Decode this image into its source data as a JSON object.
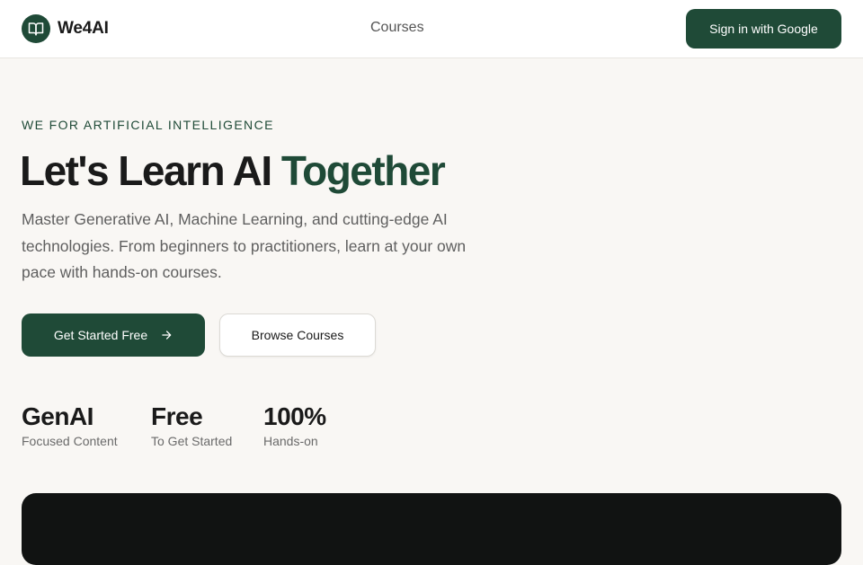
{
  "header": {
    "logo_text": "We4AI",
    "logo_icon": "book-open-icon",
    "nav_courses": "Courses",
    "signin_label": "Sign in with Google"
  },
  "hero": {
    "eyebrow": "WE FOR ARTIFICIAL INTELLIGENCE",
    "title_main": "Let's Learn AI",
    "title_accent": "Together",
    "description": "Master Generative AI, Machine Learning, and cutting-edge AI technologies. From beginners to practitioners, learn at your own pace with hands-on courses.",
    "primary_cta": "Get Started Free",
    "primary_cta_icon": "arrow-right-icon",
    "secondary_cta": "Browse Courses"
  },
  "stats": [
    {
      "value": "GenAI",
      "label": "Focused Content"
    },
    {
      "value": "Free",
      "label": "To Get Started"
    },
    {
      "value": "100%",
      "label": "Hands-on"
    }
  ],
  "colors": {
    "brand": "#1f4a37",
    "background": "#f9f7f4",
    "text": "#1a1a1a",
    "muted": "#5f5f5f"
  }
}
